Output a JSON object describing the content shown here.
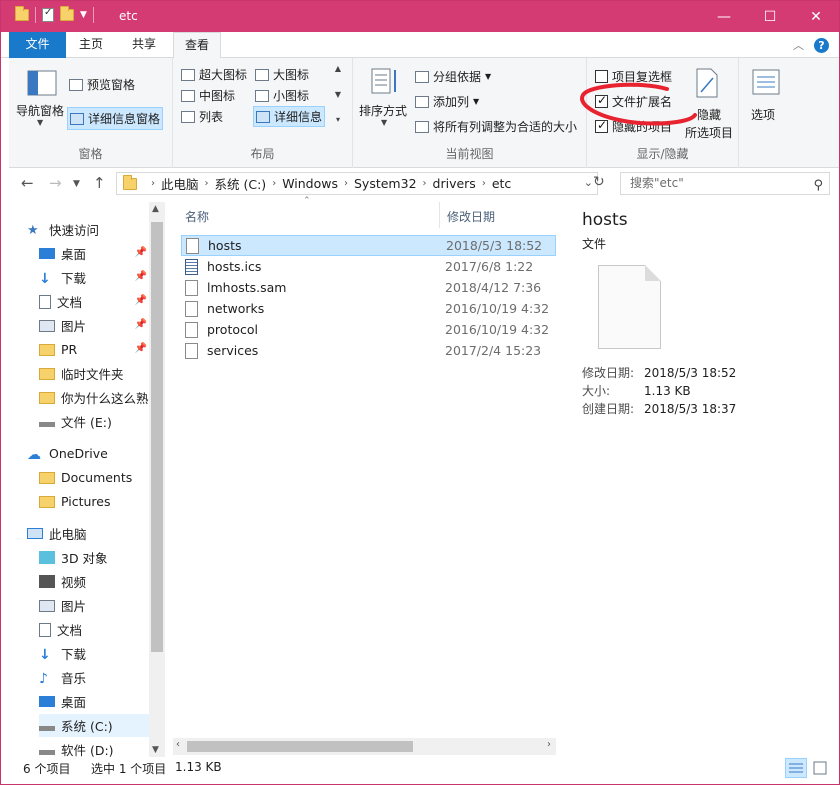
{
  "window": {
    "title": "etc",
    "controls": {
      "minimize": "—",
      "maximize": "☐",
      "close": "✕"
    }
  },
  "tabs": [
    "文件",
    "主页",
    "共享",
    "查看"
  ],
  "ribbon": {
    "panes_group": {
      "label": "窗格",
      "nav_pane": "导航窗格",
      "preview_pane": "预览窗格",
      "details_pane": "详细信息窗格"
    },
    "layout_group": {
      "label": "布局",
      "items": [
        "超大图标",
        "大图标",
        "中图标",
        "小图标",
        "列表",
        "详细信息"
      ]
    },
    "current_view_group": {
      "label": "当前视图",
      "sort_by": "排序方式",
      "group_by": "分组依据",
      "add_columns": "添加列",
      "size_all_columns": "将所有列调整为合适的大小"
    },
    "show_hide_group": {
      "label": "显示/隐藏",
      "item_checkboxes": "项目复选框",
      "file_extensions": "文件扩展名",
      "hidden_items": "隐藏的项目",
      "hide_selected": "隐藏",
      "hide_selected_2": "所选项目",
      "item_checkboxes_checked": false,
      "file_extensions_checked": true,
      "hidden_items_checked": true
    },
    "options": "选项"
  },
  "address": {
    "crumbs": [
      "此电脑",
      "系统 (C:)",
      "Windows",
      "System32",
      "drivers",
      "etc"
    ],
    "search_placeholder": "搜索\"etc\""
  },
  "nav": {
    "quick_access": "快速访问",
    "quick_items": [
      {
        "label": "桌面",
        "pinned": true
      },
      {
        "label": "下载",
        "pinned": true
      },
      {
        "label": "文档",
        "pinned": true
      },
      {
        "label": "图片",
        "pinned": true
      },
      {
        "label": "PR",
        "pinned": true
      },
      {
        "label": "临时文件夹",
        "pinned": false
      },
      {
        "label": "你为什么这么熟",
        "pinned": false
      },
      {
        "label": "文件 (E:)",
        "pinned": false
      }
    ],
    "onedrive": "OneDrive",
    "onedrive_items": [
      "Documents",
      "Pictures"
    ],
    "this_pc": "此电脑",
    "pc_items": [
      "3D 对象",
      "视频",
      "图片",
      "文档",
      "下载",
      "音乐",
      "桌面",
      "系统 (C:)",
      "软件 (D:)"
    ]
  },
  "files": {
    "col_name": "名称",
    "col_date": "修改日期",
    "rows": [
      {
        "name": "hosts",
        "date": "2018/5/3 18:52"
      },
      {
        "name": "hosts.ics",
        "date": "2017/6/8 1:22"
      },
      {
        "name": "lmhosts.sam",
        "date": "2018/4/12 7:36"
      },
      {
        "name": "networks",
        "date": "2016/10/19 4:32"
      },
      {
        "name": "protocol",
        "date": "2016/10/19 4:32"
      },
      {
        "name": "services",
        "date": "2017/2/4 15:23"
      }
    ]
  },
  "details": {
    "name": "hosts",
    "type": "文件",
    "modified_label": "修改日期:",
    "modified": "2018/5/3 18:52",
    "size_label": "大小:",
    "size": "1.13 KB",
    "created_label": "创建日期:",
    "created": "2018/5/3 18:37"
  },
  "status": {
    "count": "6 个项目",
    "selected": "选中 1 个项目",
    "selected_size": "1.13 KB"
  },
  "colors": {
    "titlebar": "#d43b73",
    "file_tab": "#1979ca",
    "selection": "#cce8ff",
    "annotation": "#e8232f"
  }
}
